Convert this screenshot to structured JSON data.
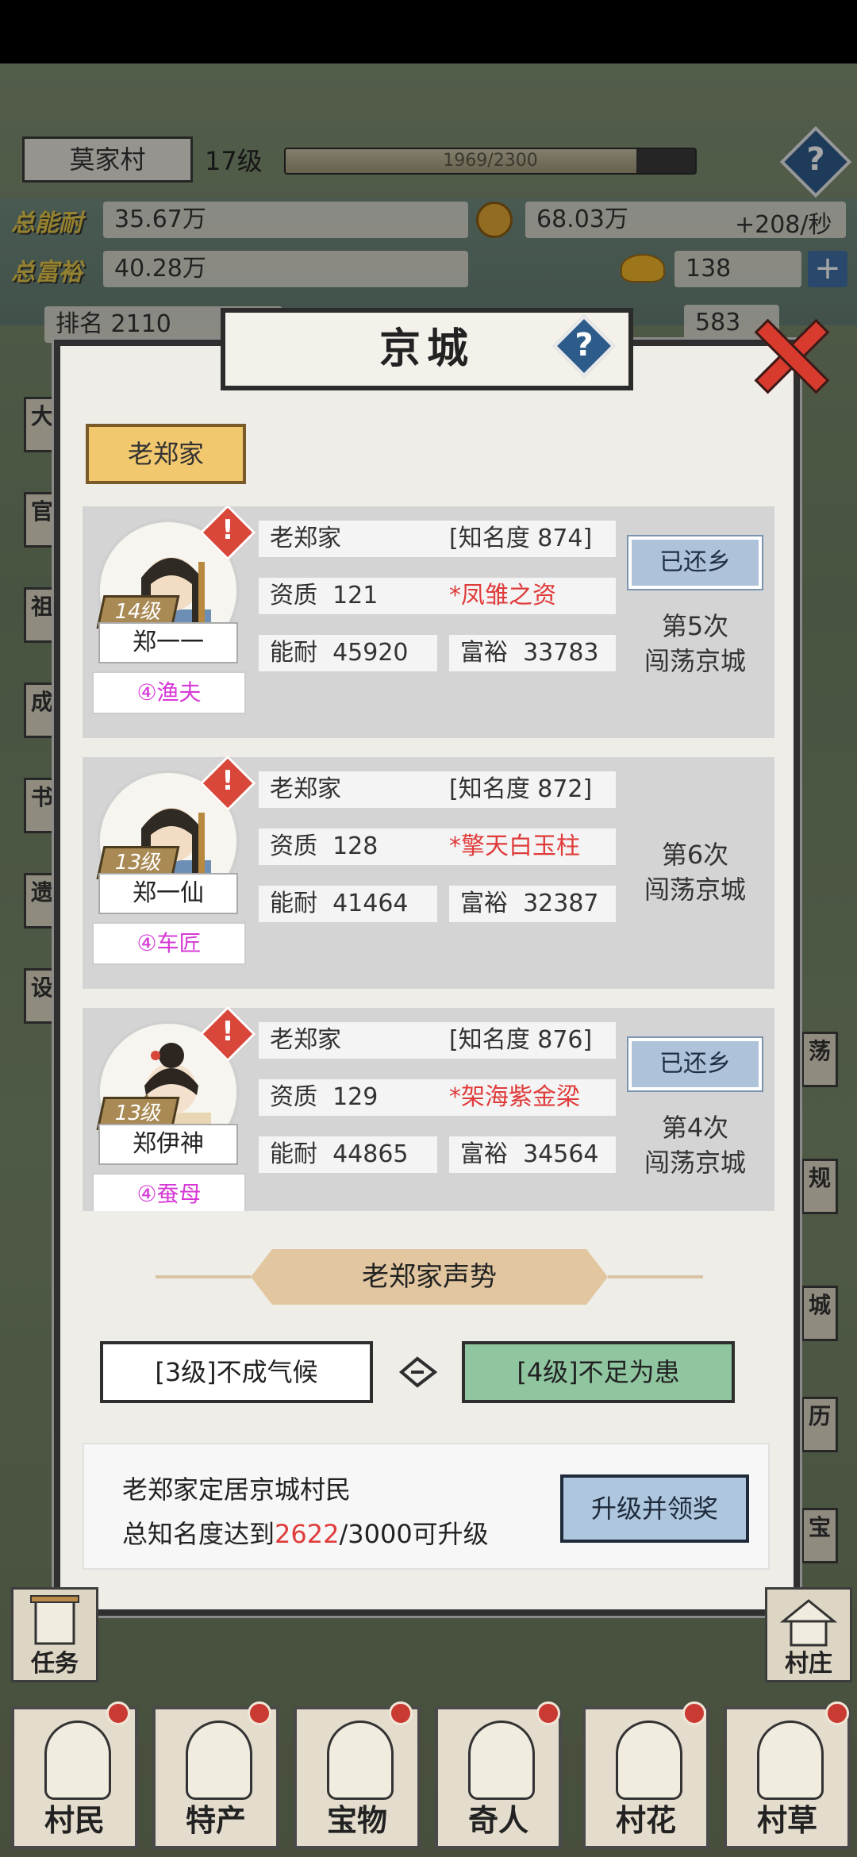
{
  "hud": {
    "village": "莫家村",
    "level": "17级",
    "xp_text": "1969/2300",
    "xp_fraction": 0.856,
    "ability_label": "总能耐",
    "ability_value": "35.67万",
    "coin_value": "68.03万",
    "coin_rate": "+208/秒",
    "wealth_label": "总富裕",
    "wealth_value": "40.28万",
    "ingot_value": "138",
    "rank_text": "排名 2110",
    "right_value": "583"
  },
  "modal": {
    "title": "京城",
    "family_tab": "老郑家",
    "members": [
      {
        "name": "郑一一",
        "level": "14级",
        "profession": "④渔夫",
        "family": "老郑家",
        "fame": "[知名度 874]",
        "aptitude_label": "资质",
        "aptitude": "121",
        "trait": "*凤雏之资",
        "ability_label": "能耐",
        "ability": "45920",
        "wealth_label": "富裕",
        "wealth": "33783",
        "status": "已还乡",
        "wander_line1": "第5次",
        "wander_line2": "闯荡京城"
      },
      {
        "name": "郑一仙",
        "level": "13级",
        "profession": "④车匠",
        "family": "老郑家",
        "fame": "[知名度 872]",
        "aptitude_label": "资质",
        "aptitude": "128",
        "trait": "*擎天白玉柱",
        "ability_label": "能耐",
        "ability": "41464",
        "wealth_label": "富裕",
        "wealth": "32387",
        "status": "",
        "wander_line1": "第6次",
        "wander_line2": "闯荡京城"
      },
      {
        "name": "郑伊神",
        "level": "13级",
        "profession": "④蚕母",
        "family": "老郑家",
        "fame": "[知名度 876]",
        "aptitude_label": "资质",
        "aptitude": "129",
        "trait": "*架海紫金梁",
        "ability_label": "能耐",
        "ability": "44865",
        "wealth_label": "富裕",
        "wealth": "34564",
        "status": "已还乡",
        "wander_line1": "第4次",
        "wander_line2": "闯荡京城"
      }
    ],
    "prestige": {
      "title": "老郑家声势",
      "current": "[3级]不成气候",
      "next": "[4级]不足为患"
    },
    "upgrade": {
      "line1": "老郑家定居京城村民",
      "line2_prefix": "总知名度达到",
      "current": "2622",
      "line2_suffix": "/3000可升级",
      "button": "升级并领奖"
    }
  },
  "side": {
    "task": "任务",
    "village": "村庄"
  },
  "nav": [
    {
      "label": "村民",
      "icon": "villager-icon"
    },
    {
      "label": "特产",
      "icon": "specialty-icon"
    },
    {
      "label": "宝物",
      "icon": "treasure-icon"
    },
    {
      "label": "奇人",
      "icon": "wizard-icon"
    },
    {
      "label": "村花",
      "icon": "belle-icon"
    },
    {
      "label": "村草",
      "icon": "handsome-icon"
    }
  ],
  "colors": {
    "accent_blue": "#aec6de",
    "alert_red": "#d9463a",
    "trait_red": "#e03b3b",
    "profession_pink": "#d63ad6",
    "next_level_green": "#8fc6a0"
  }
}
